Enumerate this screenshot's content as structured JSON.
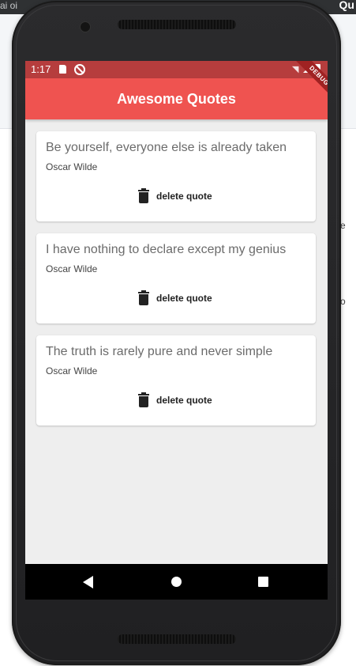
{
  "desktop": {
    "topbar_left": "ai oi",
    "topbar_right": "Qu",
    "right_panel_chars": [
      "e",
      "o"
    ]
  },
  "status_bar": {
    "time": "1:17",
    "icons": [
      "sd-card-icon",
      "sync-disabled-icon",
      "wifi-icon",
      "signal-icon",
      "battery-icon"
    ]
  },
  "app_bar": {
    "title": "Awesome Quotes",
    "debug_banner": "DEBUG",
    "color": "#ef5350"
  },
  "quotes": [
    {
      "text": "Be yourself, everyone else is already taken",
      "author": "Oscar Wilde",
      "action_label": "delete quote"
    },
    {
      "text": "I have nothing to declare except my genius",
      "author": "Oscar Wilde",
      "action_label": "delete quote"
    },
    {
      "text": "The truth is rarely pure and never simple",
      "author": "Oscar Wilde",
      "action_label": "delete quote"
    }
  ],
  "nav_bar": {
    "buttons": [
      "back-icon",
      "home-icon",
      "recents-icon"
    ]
  }
}
